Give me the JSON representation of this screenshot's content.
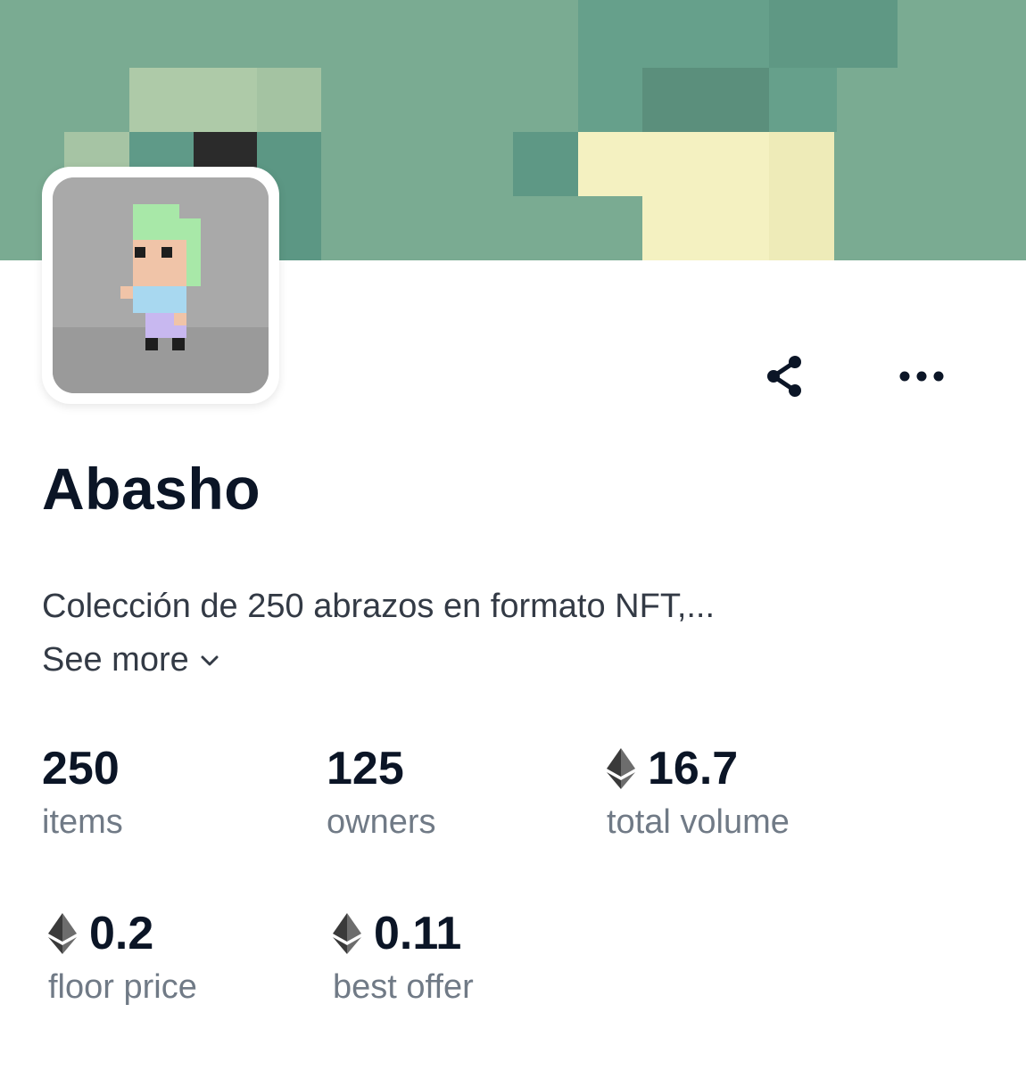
{
  "collection": {
    "name": "Abasho",
    "description": "Colección de 250 abrazos en formato NFT,...",
    "see_more_label": "See more"
  },
  "icons": {
    "share": "share-icon",
    "more": "more-horizontal-icon",
    "chevron": "chevron-down-icon",
    "eth": "ethereum-icon"
  },
  "stats": {
    "items": {
      "value": "250",
      "label": "items"
    },
    "owners": {
      "value": "125",
      "label": "owners"
    },
    "total_volume": {
      "value": "16.7",
      "label": "total volume"
    },
    "floor_price": {
      "value": "0.2",
      "label": "floor price"
    },
    "best_offer": {
      "value": "0.11",
      "label": "best offer"
    }
  },
  "colors": {
    "text_primary": "#0b1526",
    "text_secondary": "#707a86",
    "banner_green": "#7aab92",
    "avatar_bg": "#a5a5a5"
  }
}
